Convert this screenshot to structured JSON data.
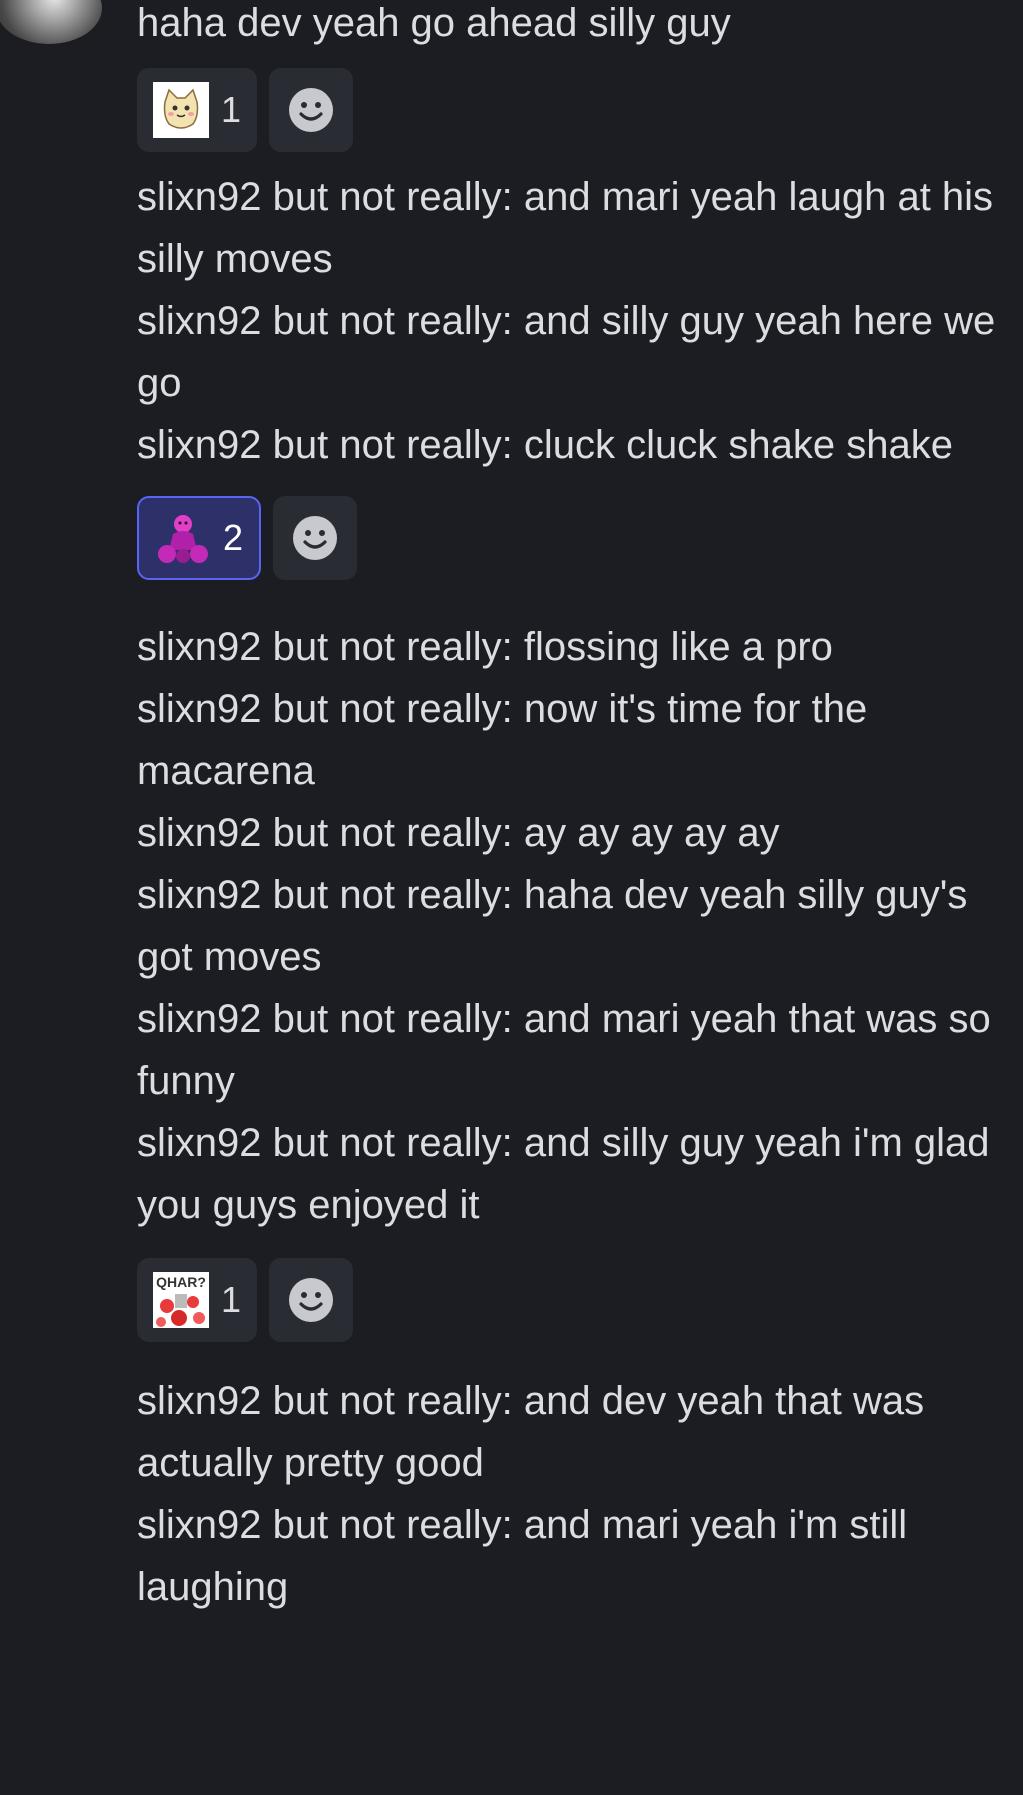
{
  "first_message": "haha dev yeah go ahead silly guy",
  "reaction_groups": [
    {
      "reactions": [
        {
          "emoji": "cat-sticker-emoji",
          "count": "1",
          "active": false
        }
      ],
      "add_icon": "smiley-icon"
    },
    {
      "reactions": [
        {
          "emoji": "pink-dancer-emoji",
          "count": "2",
          "active": true
        }
      ],
      "add_icon": "smiley-icon"
    },
    {
      "reactions": [
        {
          "emoji": "qhar-meme-emoji",
          "count": "1",
          "active": false,
          "emoji_text": "QHAR?"
        }
      ],
      "add_icon": "smiley-icon"
    }
  ],
  "messages_group_1": [
    "slixn92 but not really: and mari yeah laugh at his silly moves",
    "slixn92 but not really: and silly guy yeah here we go",
    "slixn92 but not really: cluck cluck shake shake"
  ],
  "messages_group_2": [
    "slixn92 but not really: flossing like a pro",
    "slixn92 but not really: now it's time for the macarena",
    "slixn92 but not really: ay ay ay ay ay",
    "slixn92 but not really: haha dev yeah silly guy's got moves",
    "slixn92 but not really: and mari yeah that was so funny",
    "slixn92 but not really: and silly guy yeah i'm glad you guys enjoyed it"
  ],
  "messages_group_3": [
    "slixn92 but not really: and dev yeah that was actually pretty good",
    "slixn92 but not really: and mari yeah i'm still laughing"
  ],
  "colors": {
    "background": "#1c1d23",
    "text": "#dcdde1",
    "reaction_bg": "#2a2c33",
    "reaction_active_bg": "#2d3069",
    "reaction_active_border": "#5865f2"
  }
}
